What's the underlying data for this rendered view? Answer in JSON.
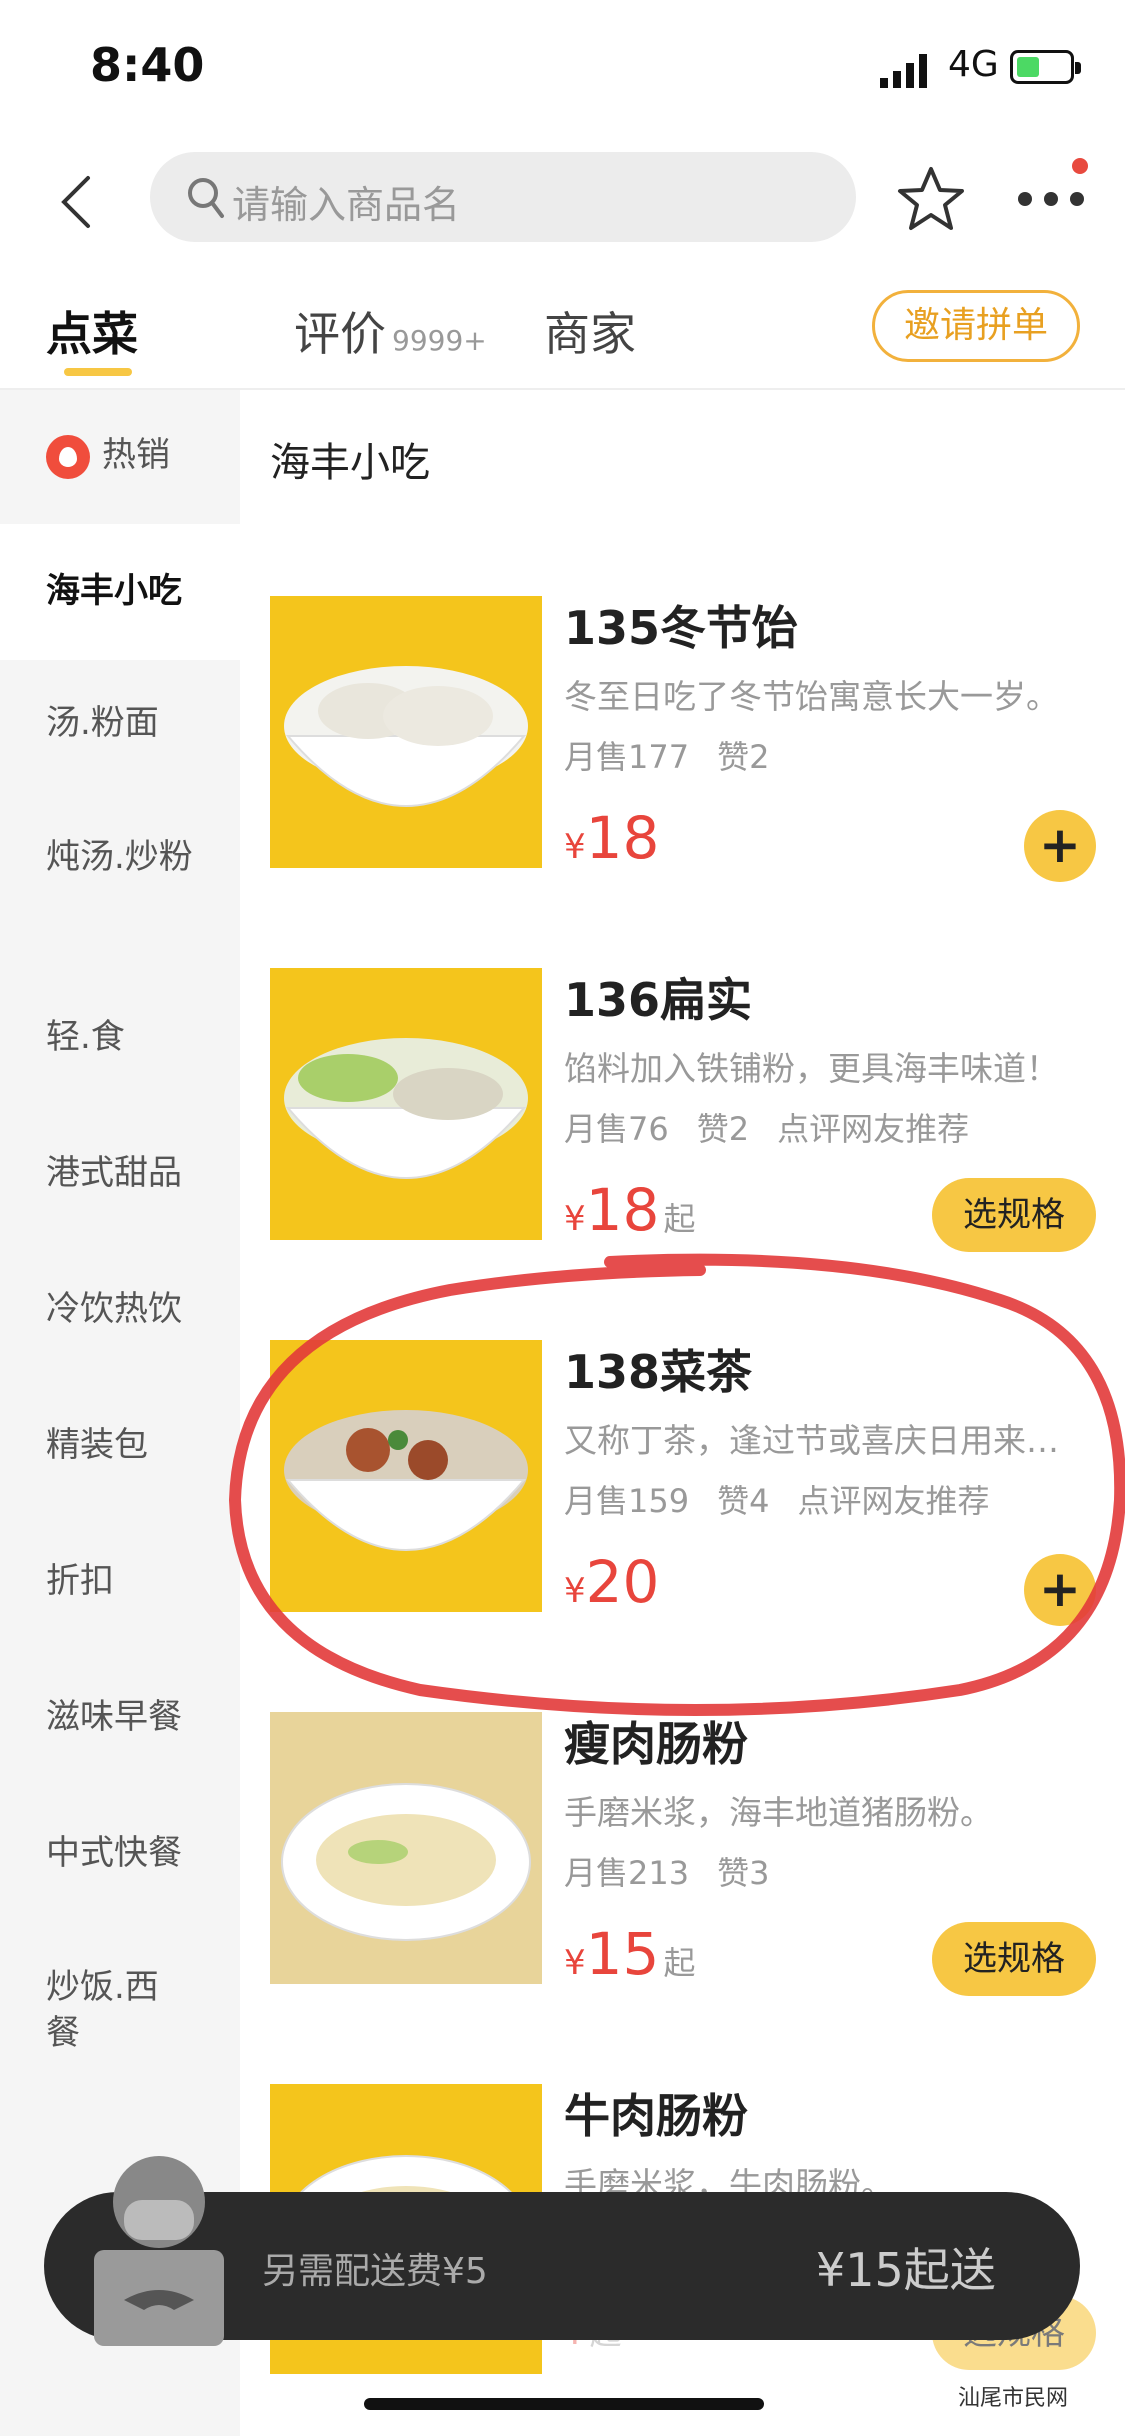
{
  "status_bar": {
    "time": "8:40",
    "network": "4G"
  },
  "nav": {
    "search_placeholder": "请输入商品名"
  },
  "tabs": {
    "order": "点菜",
    "reviews": "评价",
    "reviews_count": "9999+",
    "merchant": "商家",
    "invite": "邀请拼单"
  },
  "sidebar": {
    "items": [
      {
        "label": "热销"
      },
      {
        "label": "海丰小吃"
      },
      {
        "label": "汤.粉面"
      },
      {
        "label": "炖汤.炒粉"
      },
      {
        "label": "轻.食"
      },
      {
        "label": "港式甜品"
      },
      {
        "label": "冷饮热饮"
      },
      {
        "label": "精装包"
      },
      {
        "label": "折扣"
      },
      {
        "label": "滋味早餐"
      },
      {
        "label": "中式快餐"
      },
      {
        "label": "炒饭.西餐"
      }
    ]
  },
  "section_title": "海丰小吃",
  "products": [
    {
      "name": "135冬节饴",
      "desc": "冬至日吃了冬节饴寓意长大一岁。",
      "monthly": "月售177",
      "likes": "赞2",
      "recommend": "",
      "currency": "¥",
      "price": "18",
      "from": "",
      "action": "+"
    },
    {
      "name": "136扁实",
      "desc": "馅料加入铁铺粉，更具海丰味道！",
      "monthly": "月售76",
      "likes": "赞2",
      "recommend": "点评网友推荐",
      "currency": "¥",
      "price": "18",
      "from": "起",
      "action": "选规格"
    },
    {
      "name": "138菜茶",
      "desc": "又称丁茶，逢过节或喜庆日用来…",
      "monthly": "月售159",
      "likes": "赞4",
      "recommend": "点评网友推荐",
      "currency": "¥",
      "price": "20",
      "from": "",
      "action": "+"
    },
    {
      "name": "瘦肉肠粉",
      "desc": "手磨米浆，海丰地道猪肠粉。",
      "monthly": "月售213",
      "likes": "赞3",
      "recommend": "",
      "currency": "¥",
      "price": "15",
      "from": "起",
      "action": "选规格"
    },
    {
      "name": "牛肉肠粉",
      "desc": "手磨米浆，牛肉肠粉。",
      "monthly": "",
      "likes": "",
      "recommend": "",
      "currency": "¥",
      "price": "",
      "from": "起",
      "action": "选规格"
    }
  ],
  "cart": {
    "delivery_fee": "另需配送费¥5",
    "min_order": "¥15起送"
  },
  "watermark": "汕尾市民网",
  "colors": {
    "accent": "#f7c744",
    "price": "#e8453c",
    "annotation": "#e23a3a"
  }
}
